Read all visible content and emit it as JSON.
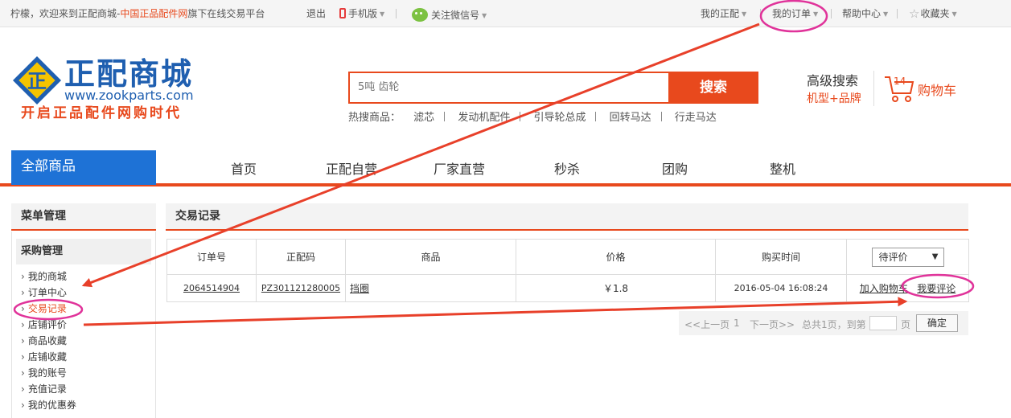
{
  "topbar": {
    "welcome_prefix": "柠檬，欢迎来到正配商城-",
    "welcome_highlight": "中国正品配件网",
    "welcome_suffix": "旗下在线交易平台",
    "logout": "退出",
    "mobile": "手机版",
    "wechat": "关注微信号",
    "my_zhengpei": "我的正配",
    "my_orders": "我的订单",
    "help": "帮助中心",
    "favorites": "收藏夹"
  },
  "logo": {
    "name": "正配商城",
    "mark": "正",
    "url": "www.zookparts.com",
    "slogan": "开启正品配件网购时代"
  },
  "search": {
    "placeholder": "5吨 齿轮",
    "button": "搜索",
    "hot_label": "热搜商品：",
    "hot_items": [
      "滤芯",
      "发动机配件",
      "引导轮总成",
      "回转马达",
      "行走马达"
    ]
  },
  "header_right": {
    "advanced_search": "高级搜索",
    "model_brand": "机型+品牌",
    "cart_count": "14",
    "cart_label": "购物车"
  },
  "nav": {
    "all": "全部商品",
    "items": [
      "首页",
      "正配自营",
      "厂家直营",
      "秒杀",
      "团购",
      "整机"
    ]
  },
  "sidebar": {
    "title": "菜单管理",
    "group": "采购管理",
    "links": [
      "我的商城",
      "订单中心",
      "交易记录",
      "店铺评价",
      "商品收藏",
      "店铺收藏",
      "我的账号",
      "充值记录",
      "我的优惠券"
    ]
  },
  "main": {
    "title": "交易记录",
    "columns": [
      "订单号",
      "正配码",
      "商品",
      "价格",
      "购买时间"
    ],
    "status_filter": "待评价",
    "rows": [
      {
        "order_no": "2064514904",
        "code": "PZ301121280005",
        "product": "挡圈",
        "price": "￥1.8",
        "time": "2016-05-04 16:08:24",
        "add_cart": "加入购物车",
        "review": "我要评论"
      }
    ],
    "pager": {
      "prev": "<<上一页",
      "page": "1",
      "next": "下一页>>",
      "total": "总共1页，到第",
      "unit": "页",
      "confirm": "确定"
    }
  },
  "colors": {
    "accent": "#e8491d",
    "nav_blue": "#1e72d6",
    "annotation": "#e0339a"
  }
}
